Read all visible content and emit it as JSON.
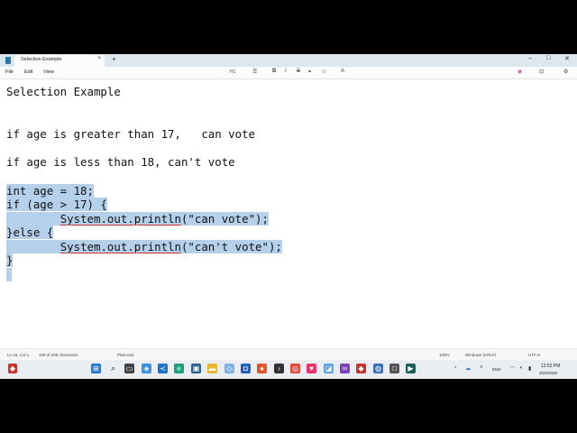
{
  "tab": {
    "title": "Selection Example",
    "close": "×",
    "new": "+"
  },
  "window_controls": {
    "minimize": "–",
    "maximize": "□",
    "close": "✕"
  },
  "menu": {
    "file": "File",
    "edit": "Edit",
    "view": "View"
  },
  "toolbar": {
    "heading": "H1",
    "list": "☰",
    "bold": "B",
    "italic": "I",
    "strike": "S",
    "link": "⚭",
    "table": "⊞",
    "clear": "A",
    "copilot": "◉",
    "settings": "⚙",
    "share": "⊡"
  },
  "document": {
    "title_line": "Selection Example",
    "line_1": "if age is greater than 17,   can vote",
    "line_2": "if age is less than 18, can't vote",
    "code": {
      "l1": "int age = 18;",
      "l2": "if (age > 17) {",
      "l3_indent": "        ",
      "l3_call": "System.out.println",
      "l3_arg": "(\"can vote\");",
      "l4": "}else {",
      "l5_indent": "        ",
      "l5_call": "System.out.println",
      "l5_arg": "(\"can't vote\");",
      "l6": "}"
    }
  },
  "statusbar": {
    "position": "Ln 15, Col 1",
    "chars": "109 of 208 characters",
    "format": "Plain text",
    "zoom": "100%",
    "line_ending": "Windows (CRLF)",
    "encoding": "UTF-8"
  },
  "taskbar": {
    "lang": "ENG",
    "time": "12:52 PM",
    "date": "3/20/2026",
    "apps": [
      "windows-start",
      "search",
      "task-view",
      "widgets",
      "chrome",
      "vscode",
      "edge",
      "store",
      "file-explorer",
      "vs",
      "outlook",
      "firefox",
      "terminal",
      "chrome",
      "pinned",
      "photos",
      "visual-studio",
      "app-red",
      "app-purple",
      "security",
      "terminal-2"
    ]
  },
  "colors": {
    "selection": "#b4d0ea",
    "spellcheck_underline": "#d03030",
    "title_bar": "#dde7ef"
  }
}
